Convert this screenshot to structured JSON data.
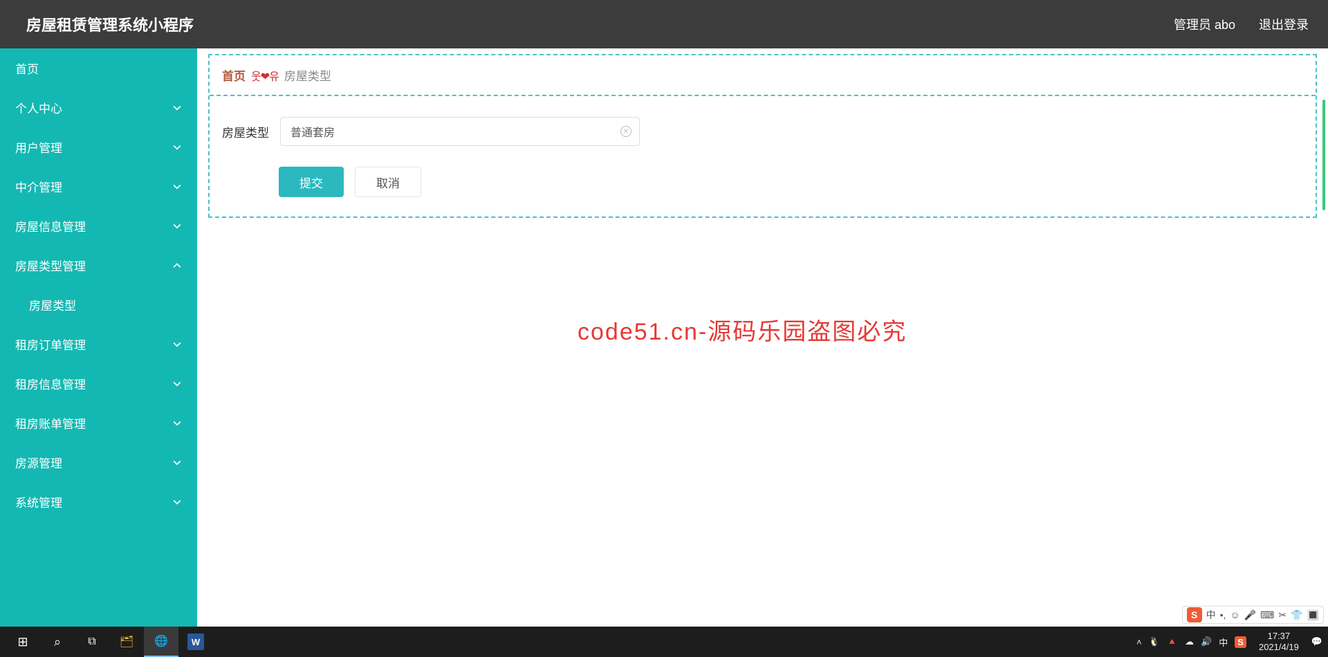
{
  "header": {
    "title": "房屋租赁管理系统小程序",
    "user": "管理员 abo",
    "logout": "退出登录"
  },
  "sidebar": {
    "items": [
      {
        "label": "首页",
        "hasChildren": false,
        "expanded": false
      },
      {
        "label": "个人中心",
        "hasChildren": true,
        "expanded": false
      },
      {
        "label": "用户管理",
        "hasChildren": true,
        "expanded": false
      },
      {
        "label": "中介管理",
        "hasChildren": true,
        "expanded": false
      },
      {
        "label": "房屋信息管理",
        "hasChildren": true,
        "expanded": false
      },
      {
        "label": "房屋类型管理",
        "hasChildren": true,
        "expanded": true
      },
      {
        "label": "房屋类型",
        "hasChildren": false,
        "sub": true
      },
      {
        "label": "租房订单管理",
        "hasChildren": true,
        "expanded": false
      },
      {
        "label": "租房信息管理",
        "hasChildren": true,
        "expanded": false
      },
      {
        "label": "租房账单管理",
        "hasChildren": true,
        "expanded": false
      },
      {
        "label": "房源管理",
        "hasChildren": true,
        "expanded": false
      },
      {
        "label": "系统管理",
        "hasChildren": true,
        "expanded": false
      }
    ]
  },
  "breadcrumb": {
    "home": "首页",
    "separator": "웃❤유",
    "current": "房屋类型"
  },
  "form": {
    "label": "房屋类型",
    "value": "普通套房",
    "submit": "提交",
    "cancel": "取消"
  },
  "watermark": {
    "small": "code51.cn",
    "big": "code51.cn-源码乐园盗图必究"
  },
  "ime": {
    "logo": "S",
    "items": [
      "中",
      "•,",
      "☺",
      "🎤",
      "⌨",
      "✂",
      "👕",
      "🔳"
    ]
  },
  "taskbar": {
    "start": "⊞",
    "clock_time": "17:37",
    "clock_date": "2021/4/19",
    "tray": [
      "🐧",
      "🔺",
      "☁",
      "🔊",
      "中",
      "S"
    ]
  }
}
